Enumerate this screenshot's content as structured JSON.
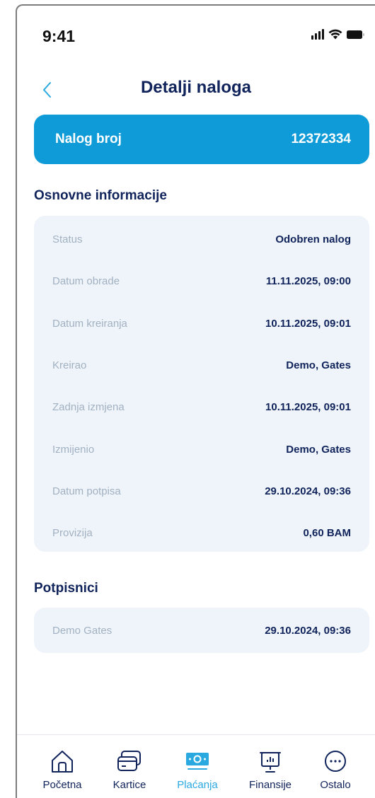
{
  "status_bar": {
    "time": "9:41"
  },
  "header": {
    "title": "Detalji naloga"
  },
  "order": {
    "label": "Nalog broj",
    "number": "12372334"
  },
  "basic_info": {
    "title": "Osnovne informacije",
    "rows": [
      {
        "label": "Status",
        "value": "Odobren nalog"
      },
      {
        "label": "Datum obrade",
        "value": "11.11.2025, 09:00"
      },
      {
        "label": "Datum kreiranja",
        "value": "10.11.2025, 09:01"
      },
      {
        "label": "Kreirao",
        "value": "Demo, Gates"
      },
      {
        "label": "Zadnja izmjena",
        "value": "10.11.2025, 09:01"
      },
      {
        "label": "Izmijenio",
        "value": "Demo, Gates"
      },
      {
        "label": "Datum potpisa",
        "value": "29.10.2024, 09:36"
      },
      {
        "label": "Provizija",
        "value": "0,60 BAM"
      }
    ]
  },
  "signers": {
    "title": "Potpisnici",
    "rows": [
      {
        "label": "Demo Gates",
        "value": "29.10.2024, 09:36"
      }
    ]
  },
  "tabbar": {
    "active_color": "#29a9e0",
    "items": [
      {
        "label": "Početna",
        "icon": "home-icon"
      },
      {
        "label": "Kartice",
        "icon": "cards-icon"
      },
      {
        "label": "Plaćanja",
        "icon": "payments-icon",
        "active": true
      },
      {
        "label": "Finansije",
        "icon": "finance-icon"
      },
      {
        "label": "Ostalo",
        "icon": "more-icon"
      }
    ]
  },
  "colors": {
    "brand": "#0e9bd8",
    "text": "#10235b",
    "card_bg": "#eef4f9",
    "label": "#a2b1c2"
  }
}
